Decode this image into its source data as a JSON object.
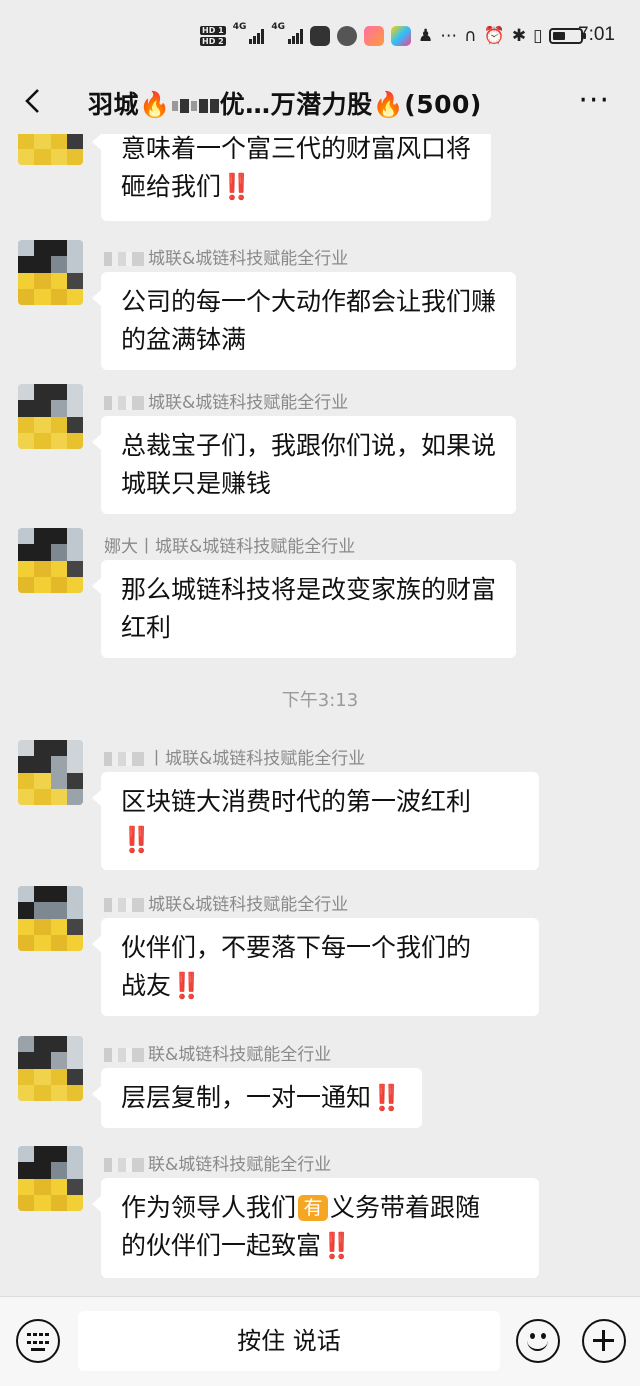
{
  "status_bar": {
    "time": "7:01",
    "network_labels": [
      "HD 1",
      "HD 2"
    ],
    "signal_labels": [
      "4G",
      "4G"
    ],
    "icons": [
      "hd-icon",
      "signal-4g-icon",
      "signal-4g-icon",
      "app-icon",
      "app-icon",
      "app-icon",
      "app-icon",
      "qq-icon",
      "more-dots-icon",
      "headphones-icon",
      "alarm-icon",
      "bluetooth-icon",
      "vibrate-icon",
      "battery-icon"
    ],
    "battery_level": 0.45
  },
  "nav": {
    "title_prefix": "羽城🔥",
    "title_suffix": "优…万潜力股🔥(500)",
    "back_icon": "chevron-left-icon",
    "more_icon": "more-icon"
  },
  "messages": [
    {
      "sender": "",
      "lines": [
        "意味着一个富三代的财富风口将",
        "砸给我们‼️"
      ]
    },
    {
      "sender": "城联&城链科技赋能全行业",
      "lines": [
        "公司的每一个大动作都会让我们赚",
        "的盆满钵满"
      ]
    },
    {
      "sender": "城联&城链科技赋能全行业",
      "lines": [
        "总裁宝子们，我跟你们说，如果说",
        "城联只是赚钱"
      ]
    },
    {
      "sender": "娜大丨城联&城链科技赋能全行业",
      "lines": [
        "那么城链科技将是改变家族的财富",
        "红利"
      ]
    },
    {
      "sender": "丨城联&城链科技赋能全行业",
      "lines": [
        "区块链大消费时代的第一波红利",
        "‼️"
      ]
    },
    {
      "sender": "城联&城链科技赋能全行业",
      "lines": [
        "伙伴们，不要落下每一个我们的",
        "战友‼️"
      ]
    },
    {
      "sender": "联&城链科技赋能全行业",
      "lines": [
        "层层复制，一对一通知‼️"
      ]
    },
    {
      "sender": "联&城链科技赋能全行业",
      "lines": [
        "作为领导人我们",
        "的伙伴们一起致富‼️"
      ],
      "badge": "有",
      "line1_tail": "义务带着跟随"
    }
  ],
  "time_separator": "下午3:13",
  "input": {
    "hold_to_talk": "按住 说话",
    "keyboard_icon": "keyboard-icon",
    "emoji_icon": "emoji-icon",
    "plus_icon": "plus-icon"
  }
}
